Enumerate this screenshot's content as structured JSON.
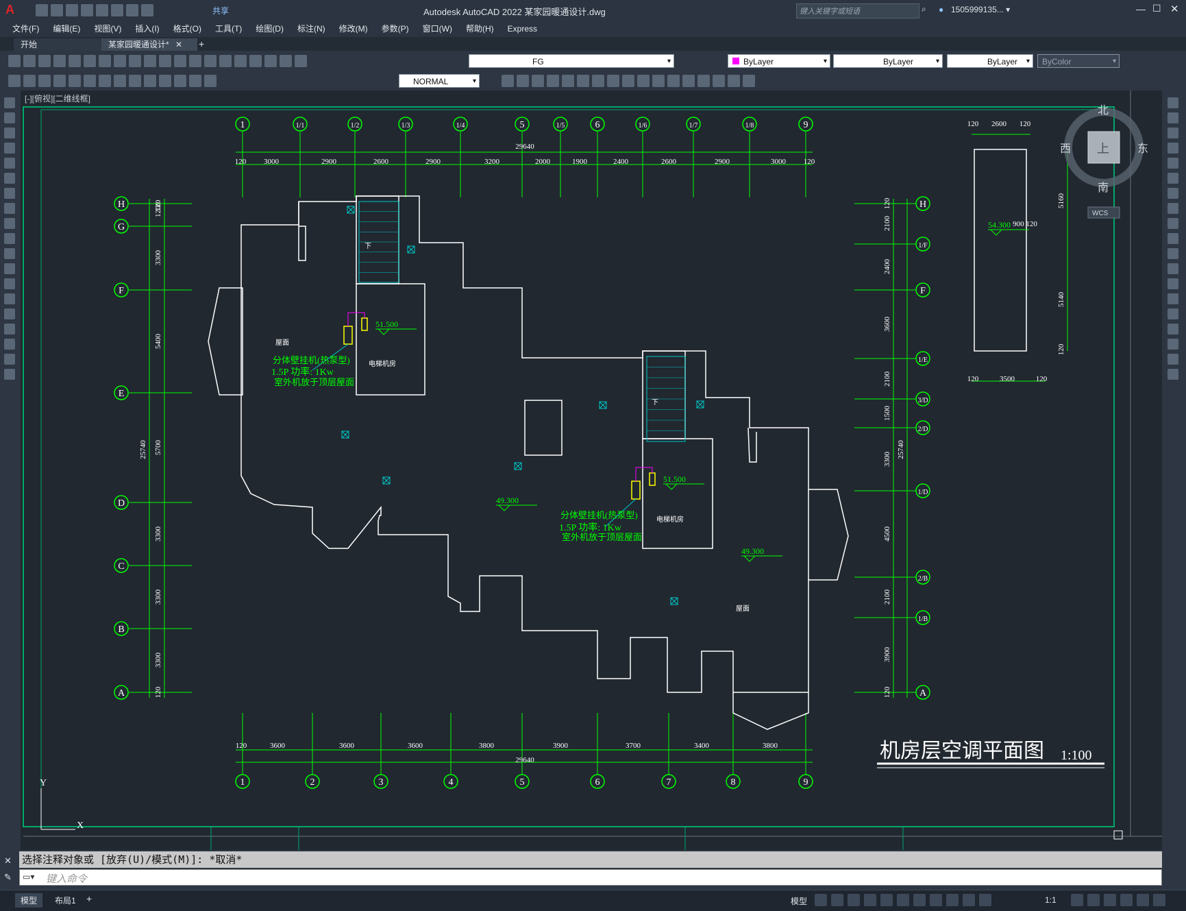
{
  "window": {
    "title": "Autodesk AutoCAD 2022    某家园暖通设计.dwg",
    "share_label": "共享",
    "search_placeholder": "键入关键字或短语",
    "user": "1505999135... ▾"
  },
  "menu": [
    "文件(F)",
    "编辑(E)",
    "视图(V)",
    "插入(I)",
    "格式(O)",
    "工具(T)",
    "绘图(D)",
    "标注(N)",
    "修改(M)",
    "参数(P)",
    "窗口(W)",
    "帮助(H)",
    "Express"
  ],
  "tabs": [
    {
      "label": "开始",
      "active": false
    },
    {
      "label": "某家园暖通设计*",
      "active": true
    }
  ],
  "toolbar": {
    "layer": "FG",
    "color": "ByLayer",
    "linetype": "ByLayer",
    "lineweight": "ByLayer",
    "plotstyle": "ByColor",
    "dimstyle": "NORMAL"
  },
  "viewport_label": "[-][俯视][二维线框]",
  "viewcube": {
    "n": "北",
    "s": "南",
    "e": "东",
    "w": "西",
    "face": "上",
    "wcs": "WCS"
  },
  "drawing": {
    "title": "机房层空调平面图",
    "scale": "1:100",
    "top_axes": [
      "1",
      "1/1",
      "1/2",
      "1/3",
      "1/4",
      "5",
      "1/5",
      "6",
      "1/6",
      "1/7",
      "1/8",
      "9"
    ],
    "top_total": "29640",
    "top_dims": [
      "120",
      "3000",
      "2900",
      "2600",
      "2900",
      "3200",
      "2000",
      "1900",
      "2400",
      "2600",
      "2900",
      "3000",
      "120"
    ],
    "bottom_axes": [
      "1",
      "2",
      "3",
      "4",
      "5",
      "6",
      "7",
      "8",
      "9"
    ],
    "bottom_total": "29640",
    "bottom_dims": [
      "120",
      "3600",
      "3600",
      "3600",
      "3800",
      "3900",
      "3700",
      "3400",
      "3800"
    ],
    "left_axes": [
      "H",
      "G",
      "F",
      "E",
      "D",
      "C",
      "B",
      "A"
    ],
    "left_total": "25740",
    "left_dims": [
      "120",
      "1200",
      "3300",
      "5400",
      "5700",
      "3300",
      "3300",
      "3300",
      "120"
    ],
    "right_axes": [
      "H",
      "1/F",
      "F",
      "1/E",
      "3/D",
      "2/D",
      "1/D",
      "2/B",
      "1/B",
      "A"
    ],
    "right_total": "25740",
    "right_dims": [
      "120",
      "2100",
      "2400",
      "3600",
      "2100",
      "1500",
      "3300",
      "4500",
      "2100",
      "3900",
      "120"
    ],
    "roof1": "屋面",
    "roof2": "屋面",
    "elev_room1": "电梯机房",
    "elev_room2": "电梯机房",
    "level_515a": "51.500",
    "level_515b": "51.500",
    "level_493a": "49.300",
    "level_493b": "49.300",
    "level_543": "54.300",
    "down1": "下",
    "down2": "下",
    "ac_note1": [
      "分体壁挂机(热泵型)",
      "1.5P  功率: 1Kw",
      "室外机放于顶层屋面"
    ],
    "ac_note2": [
      "分体壁挂机(热泵型)",
      "1.5P  功率: 1Kw",
      "室外机放于顶层屋面"
    ],
    "detail_top_dims": [
      "120",
      "2600",
      "120"
    ],
    "detail_bottom_dims": [
      "120",
      "3500",
      "120"
    ],
    "detail_right_dims": [
      "5160",
      "5140",
      "120"
    ],
    "detail_note": "900 120"
  },
  "command": {
    "history": "选择注释对象或 [放弃(U)/模式(M)]: *取消*",
    "placeholder": "键入命令"
  },
  "status": {
    "tabs": [
      "模型",
      "布局1"
    ],
    "model_label": "模型",
    "scale": "1:1"
  },
  "colors": {
    "grid_green": "#00ff00",
    "wall_white": "#ffffff",
    "cyan": "#00c8c8",
    "yellow": "#ffff00",
    "magenta": "#ff00ff",
    "frame_green": "#00a86b"
  }
}
